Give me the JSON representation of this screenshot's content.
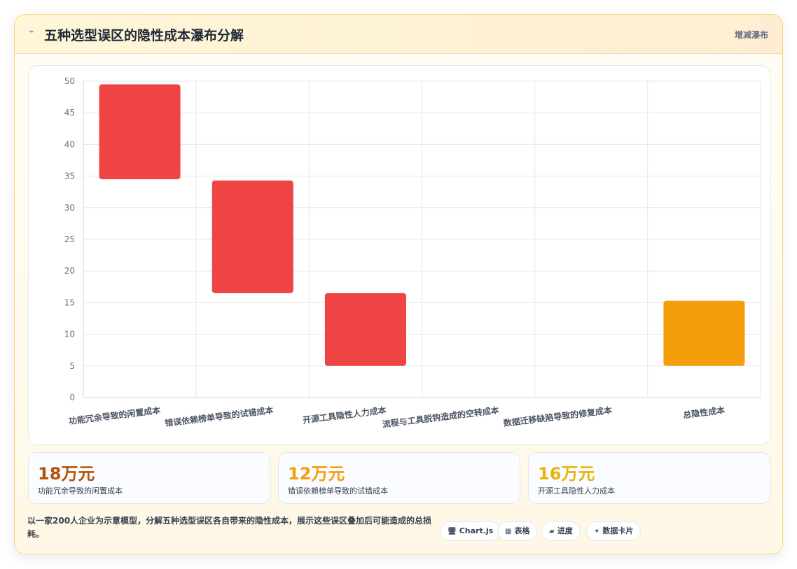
{
  "header": {
    "title_icon": "trend-icon",
    "title": "五种选型误区的隐性成本瀑布分解",
    "badge": "增减瀑布"
  },
  "colors": {
    "increase": "#ef4444",
    "total": "#f59e0b",
    "kpi1": "#b45309",
    "kpi2": "#f59e0b",
    "kpi3": "#eab308"
  },
  "chart_data": {
    "type": "bar",
    "subtype": "waterfall",
    "categories": [
      "功能冗余导致的闲置成本",
      "错误依赖榜单导致的试错成本",
      "开源工具隐性人力成本",
      "流程与工具脱钩造成的空转成本",
      "数据迁移缺陷导致的修复成本",
      "总隐性成本"
    ],
    "bars": [
      {
        "base": 34.5,
        "top": 49.5,
        "kind": "increase"
      },
      {
        "base": 16.5,
        "top": 34.3,
        "kind": "increase"
      },
      {
        "base": 5.0,
        "top": 16.5,
        "kind": "increase"
      },
      {
        "base": 0,
        "top": 0,
        "kind": "none"
      },
      {
        "base": 0,
        "top": 0,
        "kind": "none"
      },
      {
        "base": 5.0,
        "top": 15.3,
        "kind": "total"
      }
    ],
    "ylim": [
      0,
      50
    ],
    "yticks": [
      0,
      5,
      10,
      15,
      20,
      25,
      30,
      35,
      40,
      45,
      50
    ],
    "grid": true,
    "legend": "none"
  },
  "kpis": [
    {
      "value": "18万元",
      "label": "功能冗余导致的闲置成本"
    },
    {
      "value": "12万元",
      "label": "错误依赖榜单导致的试错成本"
    },
    {
      "value": "16万元",
      "label": "开源工具隐性人力成本"
    }
  ],
  "description": "以一家200人企业为示意模型，分解五种选型误区各自带来的隐性成本，展示这些误区叠加后可能造成的总损耗。",
  "tags": [
    {
      "icon": "🖥",
      "label": "Chart.js"
    },
    {
      "icon": "▦",
      "label": "表格"
    },
    {
      "icon": "▰",
      "label": "进度"
    },
    {
      "icon": "✦",
      "label": "数据卡片"
    }
  ]
}
